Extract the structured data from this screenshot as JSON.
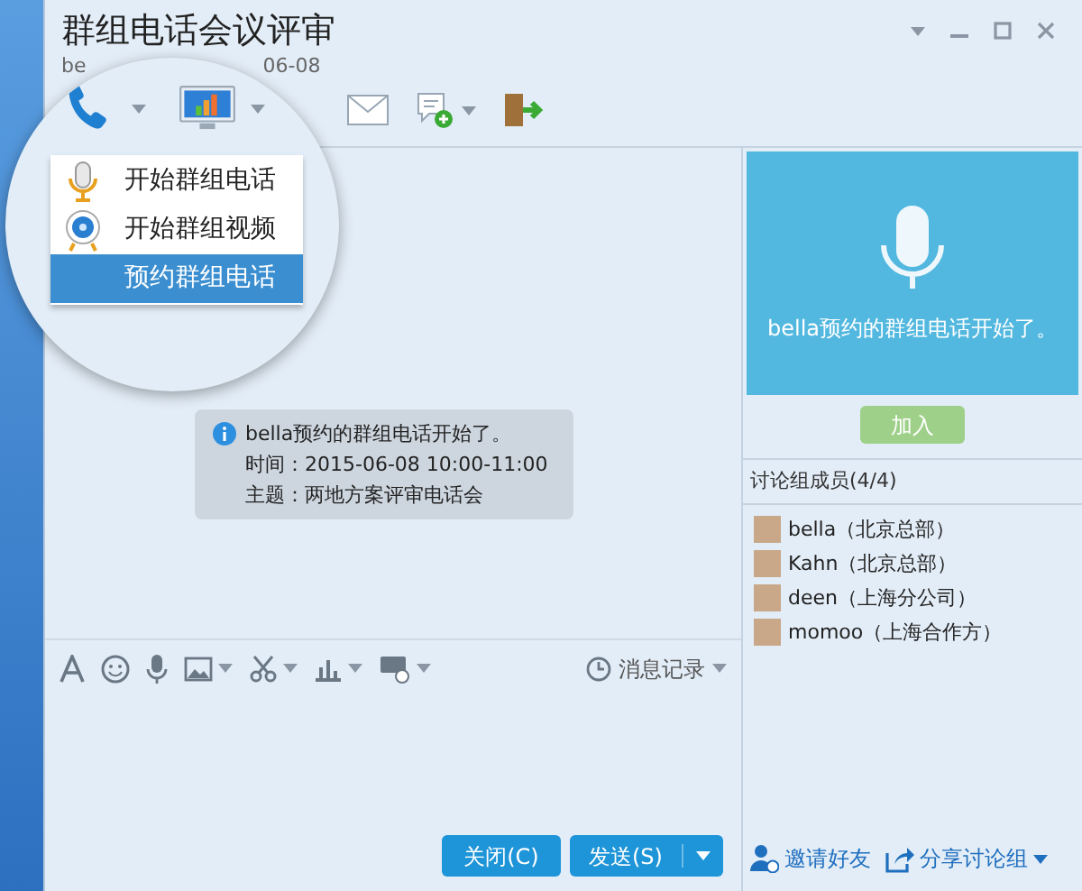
{
  "window": {
    "title": "群组电话会议评审",
    "subtitle_start": "be",
    "subtitle_end": "06-08"
  },
  "call_menu": {
    "items": [
      {
        "kind": "mic",
        "label": "开始群组电话",
        "selected": false
      },
      {
        "kind": "camera",
        "label": "开始群组视频",
        "selected": false
      },
      {
        "kind": "none",
        "label": "预约群组电话",
        "selected": true
      }
    ]
  },
  "notice": {
    "lines": [
      "bella预约的群组电话开始了。",
      "时间：2015-06-08 10:00-11:00",
      "主题：两地方案评审电话会"
    ]
  },
  "input_toolbar": {
    "history": "消息记录"
  },
  "buttons": {
    "close": "关闭(C)",
    "send": "发送(S)"
  },
  "call_card": {
    "text": "bella预约的群组电话开始了。",
    "join": "加入"
  },
  "members": {
    "header": "讨论组成员(4/4)",
    "items": [
      {
        "label": "bella（北京总部）"
      },
      {
        "label": "Kahn（北京总部）"
      },
      {
        "label": "deen（上海分公司）"
      },
      {
        "label": "momoo（上海合作方）"
      }
    ]
  },
  "footer": {
    "invite": "邀请好友",
    "share": "分享讨论组"
  }
}
